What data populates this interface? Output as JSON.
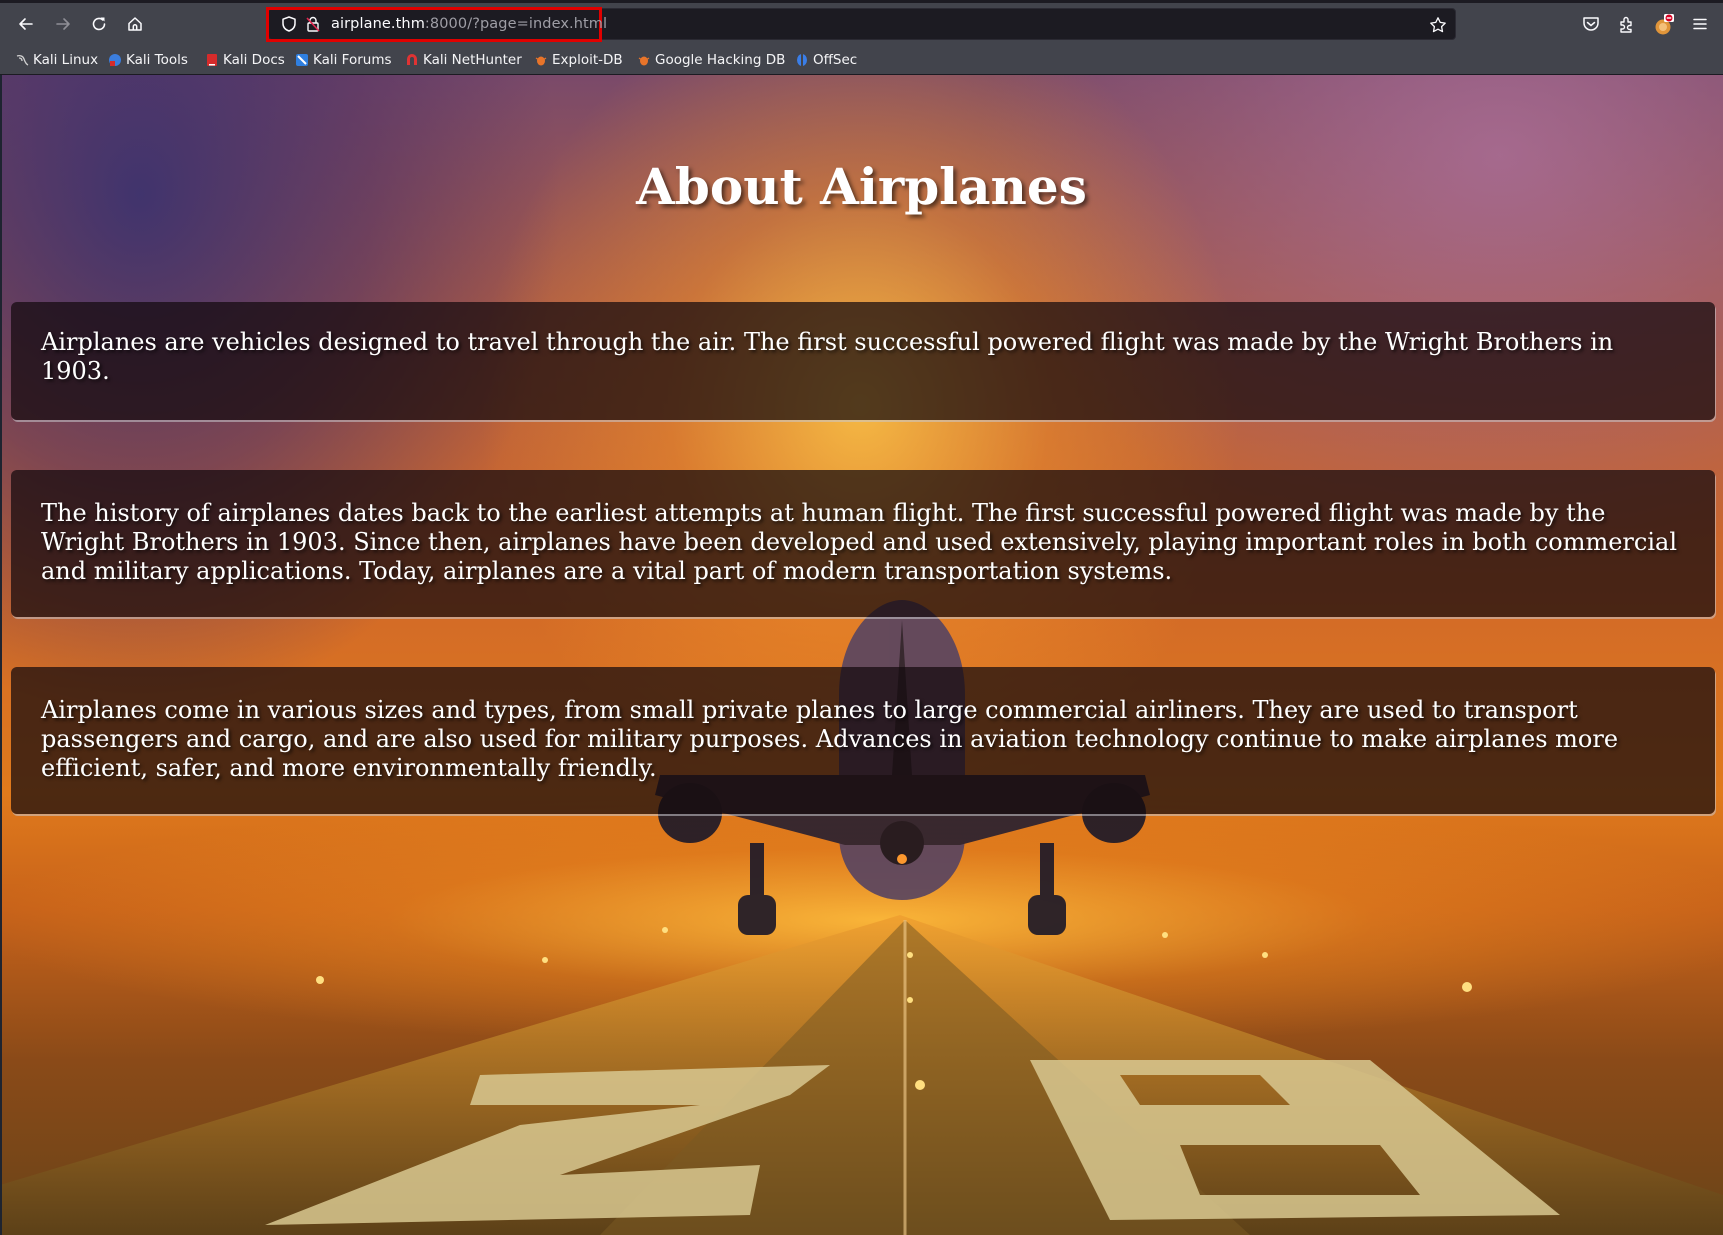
{
  "browser": {
    "url": {
      "host": "airplane.thm",
      "rest": ":8000/?page=index.html"
    },
    "nav_icons": [
      "back-arrow-icon",
      "forward-arrow-icon",
      "reload-icon",
      "home-icon"
    ],
    "toolbar_icons": [
      "pocket-icon",
      "extensions-puzzle-icon",
      "profile-avatar-icon",
      "hamburger-menu-icon"
    ],
    "highlight_color": "#e00000",
    "bookmarks": [
      {
        "label": "Kali Linux",
        "icon": "kali-dragon-icon",
        "color": "#d0d0d0"
      },
      {
        "label": "Kali Tools",
        "icon": "kali-tools-icon",
        "color": "#3b7ddd"
      },
      {
        "label": "Kali Docs",
        "icon": "kali-docs-icon",
        "color": "#d62b2b"
      },
      {
        "label": "Kali Forums",
        "icon": "kali-forums-icon",
        "color": "#2f7fe0"
      },
      {
        "label": "Kali NetHunter",
        "icon": "kali-nethunter-icon",
        "color": "#e03333"
      },
      {
        "label": "Exploit-DB",
        "icon": "exploit-db-bug-icon",
        "color": "#e8742a"
      },
      {
        "label": "Google Hacking DB",
        "icon": "ghdb-bug-icon",
        "color": "#e8742a"
      },
      {
        "label": "OffSec",
        "icon": "offsec-icon",
        "color": "#3a7ee8"
      }
    ]
  },
  "page": {
    "title": "About Airplanes",
    "paragraphs": [
      "Airplanes are vehicles designed to travel through the air. The first successful powered flight was made by the Wright Brothers in 1903.",
      "The history of airplanes dates back to the earliest attempts at human flight. The first successful powered flight was made by the Wright Brothers in 1903. Since then, airplanes have been developed and used extensively, playing important roles in both commercial and military applications. Today, airplanes are a vital part of modern transportation systems.",
      "Airplanes come in various sizes and types, from small private planes to large commercial airliners. They are used to transport passengers and cargo, and are also used for military purposes. Advances in aviation technology continue to make airplanes more efficient, safer, and more environmentally friendly."
    ],
    "background_image": "sunset-airplane-landing-on-runway-28-illustration"
  }
}
